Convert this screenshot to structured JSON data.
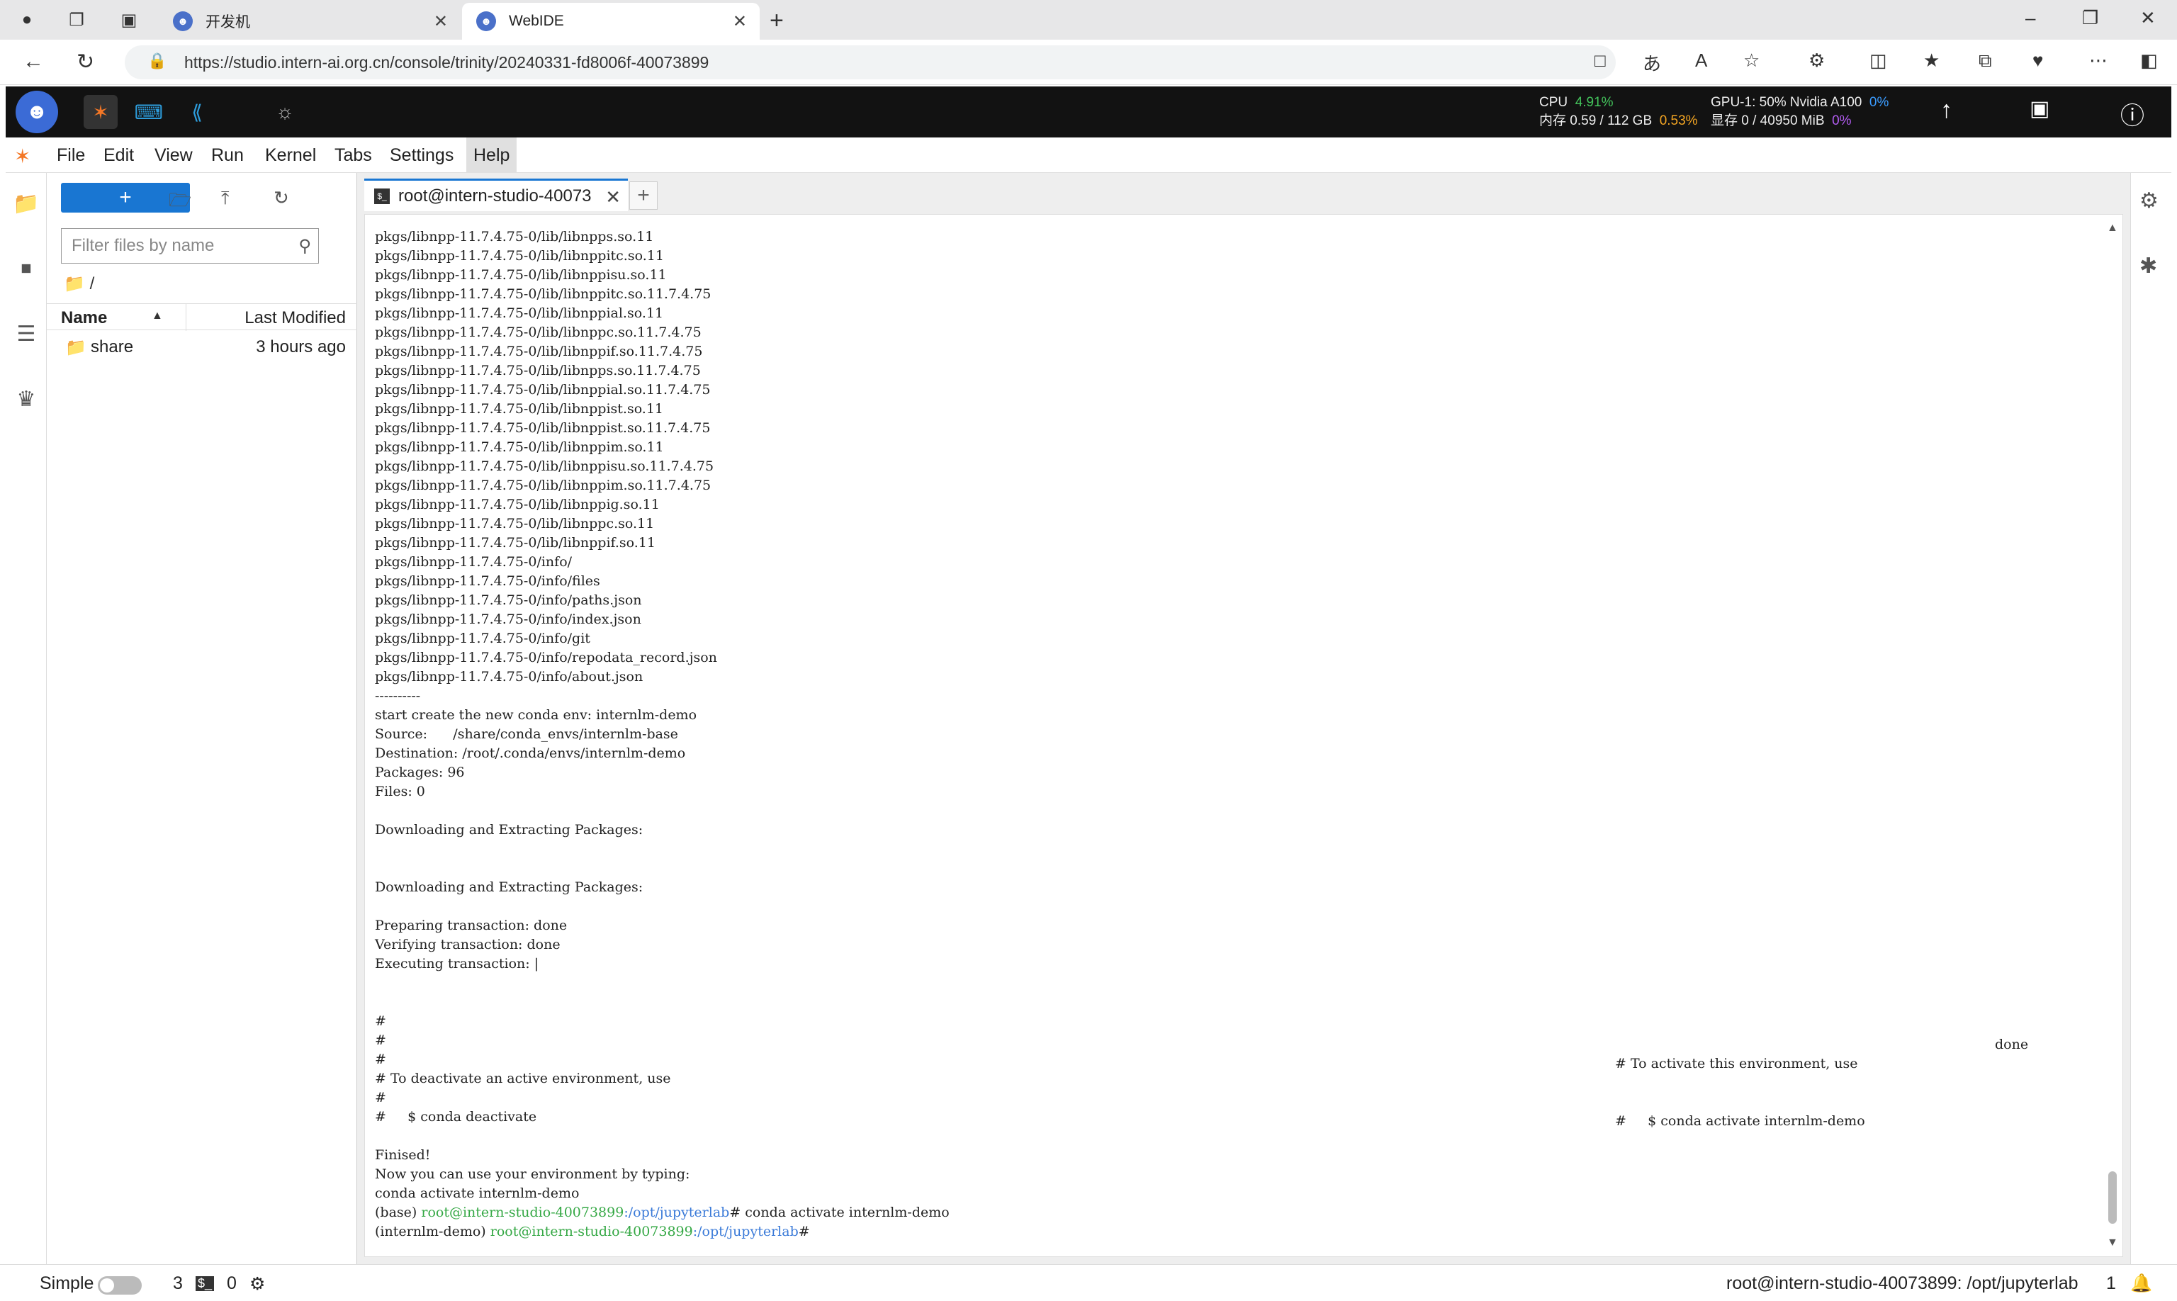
{
  "browser": {
    "tabs": [
      {
        "title": "开发机",
        "active": false
      },
      {
        "title": "WebIDE",
        "active": true
      }
    ],
    "url": "https://studio.intern-ai.org.cn/console/trinity/20240331-fd8006f-40073899"
  },
  "topbar": {
    "cpu_label": "CPU",
    "cpu_value": "4.91%",
    "mem_label": "内存 0.59 / 112 GB",
    "mem_pct": "0.53%",
    "gpu_label": "GPU-1: 50% Nvidia A100",
    "gpu_pct": "0%",
    "vram_label": "显存 0 / 40950 MiB",
    "vram_pct": "0%"
  },
  "menu": {
    "items": [
      "File",
      "Edit",
      "View",
      "Run",
      "Kernel",
      "Tabs",
      "Settings",
      "Help"
    ],
    "active": "Help"
  },
  "filebrowser": {
    "new_label": "+",
    "filter_placeholder": "Filter files by name",
    "breadcrumb": "/",
    "col_name": "Name",
    "col_modified": "Last Modified",
    "rows": [
      {
        "name": "share",
        "modified": "3 hours ago"
      }
    ]
  },
  "terminal": {
    "tab_title": "root@intern-studio-40073",
    "lines": [
      "pkgs/libnpp-11.7.4.75-0/lib/libnpps.so.11",
      "pkgs/libnpp-11.7.4.75-0/lib/libnppitc.so.11",
      "pkgs/libnpp-11.7.4.75-0/lib/libnppisu.so.11",
      "pkgs/libnpp-11.7.4.75-0/lib/libnppitc.so.11.7.4.75",
      "pkgs/libnpp-11.7.4.75-0/lib/libnppial.so.11",
      "pkgs/libnpp-11.7.4.75-0/lib/libnppc.so.11.7.4.75",
      "pkgs/libnpp-11.7.4.75-0/lib/libnppif.so.11.7.4.75",
      "pkgs/libnpp-11.7.4.75-0/lib/libnpps.so.11.7.4.75",
      "pkgs/libnpp-11.7.4.75-0/lib/libnppial.so.11.7.4.75",
      "pkgs/libnpp-11.7.4.75-0/lib/libnppist.so.11",
      "pkgs/libnpp-11.7.4.75-0/lib/libnppist.so.11.7.4.75",
      "pkgs/libnpp-11.7.4.75-0/lib/libnppim.so.11",
      "pkgs/libnpp-11.7.4.75-0/lib/libnppisu.so.11.7.4.75",
      "pkgs/libnpp-11.7.4.75-0/lib/libnppim.so.11.7.4.75",
      "pkgs/libnpp-11.7.4.75-0/lib/libnppig.so.11",
      "pkgs/libnpp-11.7.4.75-0/lib/libnppc.so.11",
      "pkgs/libnpp-11.7.4.75-0/lib/libnppif.so.11",
      "pkgs/libnpp-11.7.4.75-0/info/",
      "pkgs/libnpp-11.7.4.75-0/info/files",
      "pkgs/libnpp-11.7.4.75-0/info/paths.json",
      "pkgs/libnpp-11.7.4.75-0/info/index.json",
      "pkgs/libnpp-11.7.4.75-0/info/git",
      "pkgs/libnpp-11.7.4.75-0/info/repodata_record.json",
      "pkgs/libnpp-11.7.4.75-0/info/about.json",
      "----------",
      "start create the new conda env: internlm-demo",
      "Source:      /share/conda_envs/internlm-base",
      "Destination: /root/.conda/envs/internlm-demo",
      "Packages: 96",
      "Files: 0",
      "",
      "Downloading and Extracting Packages:",
      "",
      "",
      "Downloading and Extracting Packages:",
      "",
      "Preparing transaction: done",
      "Verifying transaction: done",
      "Executing transaction: |",
      "",
      "",
      "#",
      "#",
      "#",
      "# To deactivate an active environment, use",
      "#",
      "#     $ conda deactivate",
      "",
      "Finised!",
      "Now you can use your environment by typing:",
      "conda activate internlm-demo"
    ],
    "right_lines": [
      "done",
      "# To activate this environment, use",
      "#     $ conda activate internlm-demo"
    ],
    "prompt1": {
      "env": "(base) ",
      "user": "root@intern-studio-40073899",
      "path": ":/opt/jupyterlab",
      "cmd": "# conda activate internlm-demo"
    },
    "prompt2": {
      "env": "(internlm-demo) ",
      "user": "root@intern-studio-40073899",
      "path": ":/opt/jupyterlab",
      "cmd": "#"
    }
  },
  "status": {
    "mode": "Simple",
    "terminals": "3",
    "kernels": "0",
    "right_text": "root@intern-studio-40073899: /opt/jupyterlab",
    "notifications": "1"
  }
}
